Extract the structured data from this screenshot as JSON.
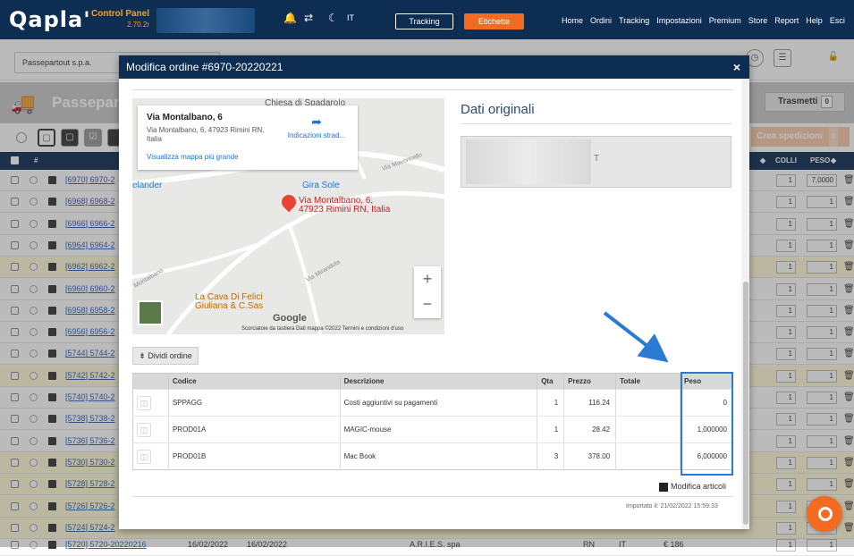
{
  "topbar": {
    "logo": "Qapla'",
    "control_panel": "Control Panel",
    "version": "2.70.2r",
    "lang": "IT",
    "tracking_btn": "Tracking",
    "etichette_btn": "Etichette",
    "nav": [
      "Home",
      "Ordini",
      "Tracking",
      "Impostazioni",
      "Premium",
      "Store",
      "Report",
      "Help",
      "Esci"
    ]
  },
  "subbar": {
    "company": "Passepartout s.p.a."
  },
  "band": {
    "title": "Passeparto",
    "trasmetti": "Trasmetti",
    "trasmetti_count": "0",
    "crea": "Crea spedizioni",
    "crea_count": "0"
  },
  "table": {
    "col_colli": "COLLI",
    "col_peso": "PESO",
    "rows": [
      {
        "link": "[6970] 6970-2",
        "colli": "1",
        "peso": "7,0000",
        "yellow": false
      },
      {
        "link": "[6968] 6968-2",
        "colli": "1",
        "peso": "1",
        "yellow": false
      },
      {
        "link": "[6966] 6966-2",
        "colli": "1",
        "peso": "1",
        "yellow": false
      },
      {
        "link": "[6964] 6964-2",
        "colli": "1",
        "peso": "1",
        "yellow": false
      },
      {
        "link": "[6962] 6962-2",
        "colli": "1",
        "peso": "1",
        "yellow": true
      },
      {
        "link": "[6960] 6960-2",
        "colli": "1",
        "peso": "1",
        "yellow": false
      },
      {
        "link": "[6958] 6958-2",
        "colli": "1",
        "peso": "1",
        "yellow": false
      },
      {
        "link": "[6956] 6956-2",
        "colli": "1",
        "peso": "1",
        "yellow": false
      },
      {
        "link": "[5744] 5744-2",
        "colli": "1",
        "peso": "1",
        "yellow": false
      },
      {
        "link": "[5742] 5742-2",
        "colli": "1",
        "peso": "1",
        "yellow": true
      },
      {
        "link": "[5740] 5740-2",
        "colli": "1",
        "peso": "1",
        "yellow": false
      },
      {
        "link": "[5738] 5738-2",
        "colli": "1",
        "peso": "1",
        "yellow": false
      },
      {
        "link": "[5736] 5736-2",
        "colli": "1",
        "peso": "1",
        "yellow": false
      },
      {
        "link": "[5730] 5730-2",
        "colli": "1",
        "peso": "1",
        "yellow": true
      },
      {
        "link": "[5728] 5728-2",
        "colli": "1",
        "peso": "1",
        "yellow": true
      },
      {
        "link": "[5726] 5726-2",
        "colli": "1",
        "peso": "1",
        "yellow": true
      },
      {
        "link": "[5724] 5724-2",
        "colli": "1",
        "peso": "1",
        "yellow": true
      }
    ],
    "last_row": {
      "link": "[5720] 5720-20220216",
      "date1": "16/02/2022",
      "date2": "16/02/2022",
      "company": "A.R.I.E.S. spa",
      "prov": "RN",
      "country": "IT",
      "amount": "€ 186",
      "colli": "1",
      "peso": "1"
    }
  },
  "modal": {
    "title": "Modifica ordine #6970-20220221",
    "map": {
      "card_title": "Via Montalbano, 6",
      "card_address": "Via Montalbano, 6, 47923 Rimini RN, Italia",
      "directions": "Indicazioni strad...",
      "bigger_map": "Visualizza mappa più grande",
      "labels": {
        "chiesa": "Chiesa di Spadarolo",
        "elander": "elander",
        "girasole": "Gira Sole",
        "pin_label": "Via Montalbano, 6, 47923 Rimini RN, Italia",
        "via_mavoncello": "Via Mavoncello",
        "via_mirandola": "Via Mirandola",
        "montalbano": "Montalbano",
        "cava": "La Cava Di Felici Giuliana & C.Sas",
        "google": "Google",
        "footer": "Scorciatoie da tastiera   Dati mappa ©2022   Termini e condizioni d'uso"
      }
    },
    "dati_originali": "Dati originali",
    "dati_t": "T",
    "dividi": "Dividi ordine",
    "items_headers": {
      "codice": "Codice",
      "descrizione": "Descrizione",
      "qta": "Qta",
      "prezzo": "Prezzo",
      "totale": "Totale",
      "peso": "Peso"
    },
    "items": [
      {
        "codice": "SPPAGG",
        "descrizione": "Costi aggiuntivi su pagamenti",
        "qta": "1",
        "prezzo": "116.24",
        "totale": "",
        "peso": "0"
      },
      {
        "codice": "PROD01A",
        "descrizione": "MAGIC-mouse",
        "qta": "1",
        "prezzo": "28.42",
        "totale": "",
        "peso": "1,000000"
      },
      {
        "codice": "PROD01B",
        "descrizione": "Mac Book",
        "qta": "3",
        "prezzo": "378.00",
        "totale": "",
        "peso": "6,000000"
      }
    ],
    "modifica_articoli": "Modifica articoli",
    "importato": "Importato il: 21/02/2022 15:59:33"
  }
}
